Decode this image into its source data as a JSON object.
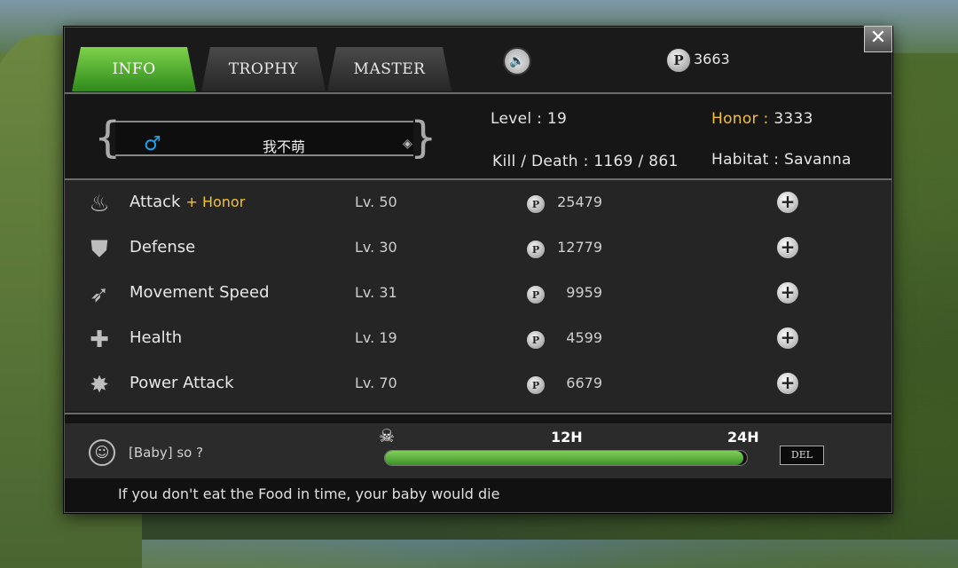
{
  "tabs": [
    {
      "label": "INFO",
      "active": true
    },
    {
      "label": "TROPHY",
      "active": false
    },
    {
      "label": "MASTER",
      "active": false
    }
  ],
  "currency": {
    "icon": "P",
    "amount": "3663"
  },
  "profile": {
    "name": "我不萌",
    "gender_symbol": "♂",
    "level_label": "Level :",
    "level_value": "19",
    "honor_label": "Honor :",
    "honor_value": "3333",
    "kd_label": "Kill / Death :",
    "kd_value": "1169 / 861",
    "habitat_label": "Habitat :",
    "habitat_value": "Savanna"
  },
  "upgrades": [
    {
      "icon": "flame-icon",
      "glyph": "♨",
      "name": "Attack",
      "suffix": "+ Honor",
      "level": "Lv. 50",
      "coin": "P",
      "cost": "25479"
    },
    {
      "icon": "shield-icon",
      "glyph": "⛊",
      "name": "Defense",
      "suffix": "",
      "level": "Lv. 30",
      "coin": "P",
      "cost": "12779"
    },
    {
      "icon": "wing-icon",
      "glyph": "➶",
      "name": "Movement Speed",
      "suffix": "",
      "level": "Lv. 31",
      "coin": "P",
      "cost": "9959"
    },
    {
      "icon": "health-cross-icon",
      "glyph": "✚",
      "name": "Health",
      "suffix": "",
      "level": "Lv. 19",
      "coin": "P",
      "cost": "4599"
    },
    {
      "icon": "burst-icon",
      "glyph": "✸",
      "name": "Power Attack",
      "suffix": "",
      "level": "Lv. 70",
      "coin": "P",
      "cost": "6679"
    }
  ],
  "baby": {
    "message": "[Baby]  so ?",
    "mark_12": "12H",
    "mark_24": "24H",
    "progress": 0.99,
    "del_label": "DEL"
  },
  "footer_text": "If you don't eat the Food in time, your baby would die",
  "colors": {
    "active_tab": "#5cb83a",
    "honor": "#f3c233",
    "gender": "#1fa3e8",
    "progress": "#5fb53d"
  }
}
